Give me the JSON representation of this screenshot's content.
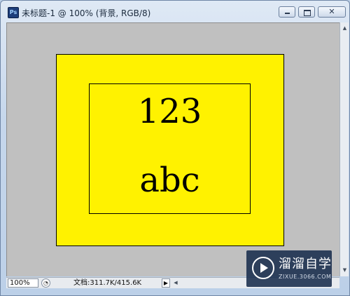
{
  "window": {
    "title": "未标题-1 @ 100% (背景, RGB/8)",
    "app_icon": "ps-icon",
    "buttons": {
      "minimize": "minimize-icon",
      "maximize": "maximize-icon",
      "close_glyph": "✕"
    }
  },
  "document": {
    "background_color": "#fff200",
    "canvas_color": "#c0c0c0",
    "text_line_1": "123",
    "text_line_2": "abc"
  },
  "statusbar": {
    "zoom": "100%",
    "doc_size": "文档:311.7K/415.6K"
  },
  "watermark": {
    "name": "溜溜自学",
    "url": "ZIXUE.3066.COM"
  }
}
